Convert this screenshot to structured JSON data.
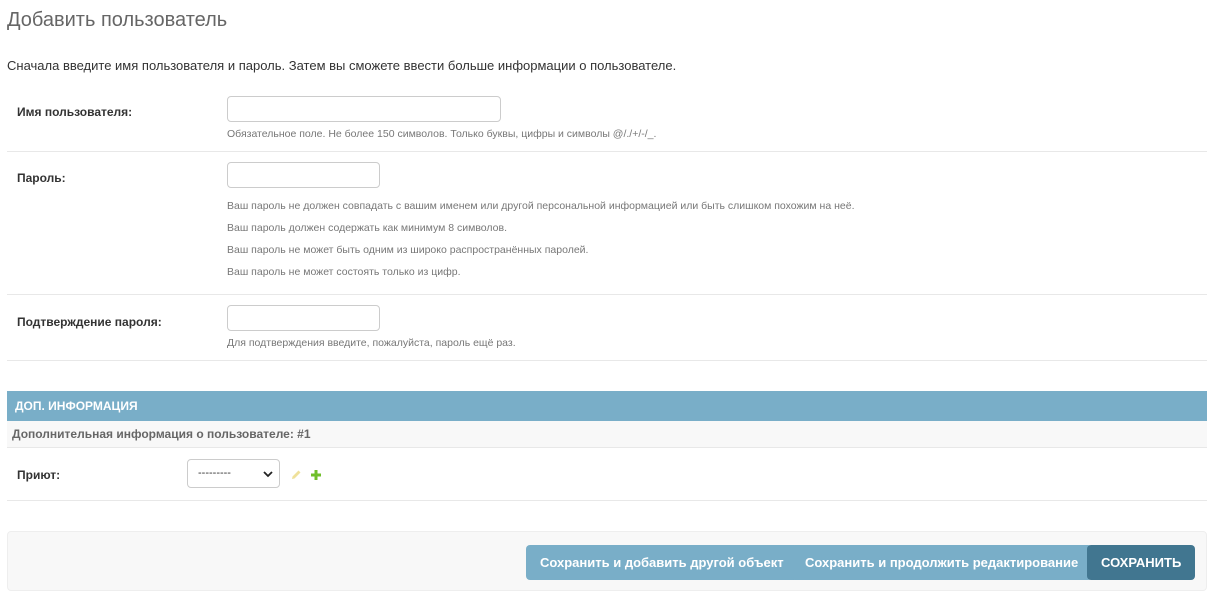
{
  "page": {
    "title": "Добавить пользователь",
    "intro": "Сначала введите имя пользователя и пароль. Затем вы сможете ввести больше информации о пользователе."
  },
  "fields": {
    "username": {
      "label": "Имя пользователя:",
      "value": "",
      "help": "Обязательное поле. Не более 150 символов. Только буквы, цифры и символы @/./+/-/_."
    },
    "password": {
      "label": "Пароль:",
      "value": "",
      "help": [
        "Ваш пароль не должен совпадать с вашим именем или другой персональной информацией или быть слишком похожим на неё.",
        "Ваш пароль должен содержать как минимум 8 символов.",
        "Ваш пароль не может быть одним из широко распространённых паролей.",
        "Ваш пароль не может состоять только из цифр."
      ]
    },
    "password_confirm": {
      "label": "Подтверждение пароля:",
      "value": "",
      "help": "Для подтверждения введите, пожалуйста, пароль ещё раз."
    }
  },
  "inline": {
    "module_title": "Доп. информация",
    "item_title": "Дополнительная информация о пользователе: #1",
    "shelter_label": "Приют:",
    "shelter_selected": "---------",
    "edit_icon": "pencil-icon",
    "add_icon": "plus-icon"
  },
  "buttons": {
    "save_add_another": "Сохранить и добавить другой объект",
    "save_continue": "Сохранить и продолжить редактирование",
    "save": "Сохранить"
  },
  "colors": {
    "module_header": "#79aec8",
    "primary_button": "#417690",
    "secondary_button": "#79aec8",
    "edit_icon": "#efe19b",
    "add_icon": "#70bf2b"
  }
}
